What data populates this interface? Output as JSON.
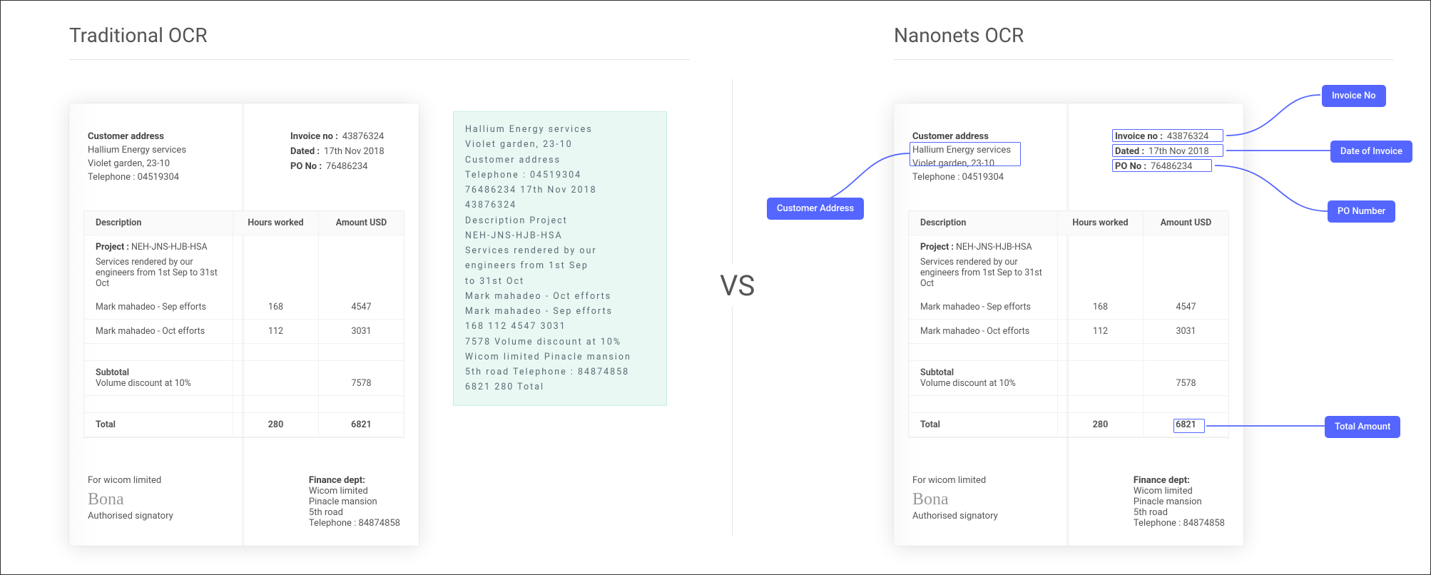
{
  "headings": {
    "left": "Traditional OCR",
    "right": "Nanonets OCR",
    "vs": "VS"
  },
  "invoice": {
    "customer_heading": "Customer address",
    "customer_lines": [
      "Hallium Energy services",
      "Violet garden, 23-10",
      "Telephone : 04519304"
    ],
    "meta": {
      "invoice_no_k": "Invoice no :",
      "invoice_no_v": "43876324",
      "dated_k": "Dated :",
      "dated_v": "17th Nov 2018",
      "po_k": "PO No :",
      "po_v": "76486234"
    },
    "table": {
      "cols": [
        "Description",
        "Hours worked",
        "Amount USD"
      ],
      "project_k": "Project :",
      "project_v": "NEH-JNS-HJB-HSA",
      "project_desc": "Services rendered by our engineers from 1st Sep to 31st Oct",
      "rows": [
        {
          "desc": "Mark mahadeo - Sep efforts",
          "hours": "168",
          "amt": "4547"
        },
        {
          "desc": "Mark mahadeo - Oct efforts",
          "hours": "112",
          "amt": "3031"
        }
      ],
      "subtotal_k": "Subtotal",
      "discount_k": "Volume discount at 10%",
      "discount_v": "7578",
      "total_k": "Total",
      "total_hours": "280",
      "total_amt": "6821"
    },
    "footer": {
      "left_1": "For wicom limited",
      "left_sig": "Authorised signatory",
      "right_head": "Finance dept:",
      "right_lines": [
        "Wicom limited",
        "Pinacle mansion",
        "5th road",
        "Telephone : 84874858"
      ]
    }
  },
  "raw_ocr": [
    "Hallium Energy services",
    "Violet garden, 23-10",
    "Customer address",
    "Telephone : 04519304",
    "76486234 17th Nov 2018",
    "43876324",
    "Description Project",
    "NEH-JNS-HJB-HSA",
    "Services rendered by our",
    "engineers from 1st Sep",
    "to 31st Oct",
    "Mark mahadeo - Oct efforts",
    "Mark mahadeo - Sep efforts",
    "168 112 4547 3031",
    "7578 Volume discount at 10%",
    "Wicom limited Pinacle mansion",
    "5th road Telephone : 84874858",
    "6821 280 Total"
  ],
  "tags": {
    "customer_address": "Customer Address",
    "invoice_no": "Invoice No",
    "date_of_invoice": "Date of Invoice",
    "po_number": "PO Number",
    "total_amount": "Total Amount"
  }
}
